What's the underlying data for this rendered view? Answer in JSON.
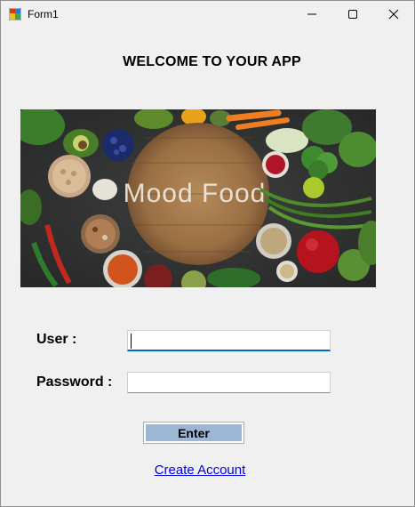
{
  "window": {
    "title": "Form1",
    "icon": "winforms-app-icon",
    "controls": {
      "minimize_icon": "minimize-icon",
      "maximize_icon": "maximize-icon",
      "close_icon": "close-icon"
    }
  },
  "main": {
    "welcome_text": "WELCOME TO YOUR APP",
    "banner": {
      "logo_text": "Mood Food",
      "image_description_icon": "food-banner-image"
    },
    "user_label": "User :",
    "user_value": "",
    "password_label": "Password :",
    "password_value": "",
    "enter_label": "Enter",
    "create_account_label": "Create Account"
  },
  "colors": {
    "window_bg": "#f0f0f0",
    "button_fill": "#9cb6d4",
    "focus_underline": "#0067c0",
    "link": "#0000ee"
  }
}
